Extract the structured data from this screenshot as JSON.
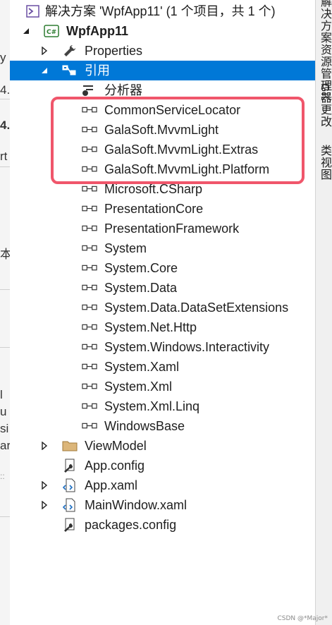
{
  "left_strip": {
    "fragments": [
      "y",
      "4.",
      "4.",
      "rt",
      "本",
      "l",
      "u",
      "si",
      "ar",
      "::"
    ]
  },
  "solution": {
    "label": "解决方案 'WpfApp11' (1 个项目，共 1 个)",
    "project": {
      "label": "WpfApp11",
      "badge": "C#",
      "items": {
        "properties": "Properties",
        "references": "引用",
        "analyzer": "分析器",
        "viewmodel": "ViewModel",
        "app_config": "App.config",
        "app_xaml": "App.xaml",
        "main_window": "MainWindow.xaml",
        "packages_config": "packages.config"
      },
      "references": [
        "CommonServiceLocator",
        "GalaSoft.MvvmLight",
        "GalaSoft.MvvmLight.Extras",
        "GalaSoft.MvvmLight.Platform",
        "Microsoft.CSharp",
        "PresentationCore",
        "PresentationFramework",
        "System",
        "System.Core",
        "System.Data",
        "System.Data.DataSetExtensions",
        "System.Net.Http",
        "System.Windows.Interactivity",
        "System.Xaml",
        "System.Xml",
        "System.Xml.Linq",
        "WindowsBase"
      ]
    }
  },
  "right_rail": {
    "tabs": [
      "解决方案资源管理器",
      "Git 更改",
      "类视图"
    ]
  },
  "watermark": "CSDN @*Major*",
  "colors": {
    "selection": "#0078d7",
    "highlight_border": "#f0566b"
  },
  "icons": {
    "solution": "solution-icon",
    "project": "csharp-project-icon",
    "properties": "wrench-icon",
    "references": "references-icon",
    "analyzer": "analyzer-icon",
    "reference": "assembly-reference-icon",
    "folder": "folder-icon",
    "config": "config-file-icon",
    "xaml": "xaml-file-icon"
  }
}
